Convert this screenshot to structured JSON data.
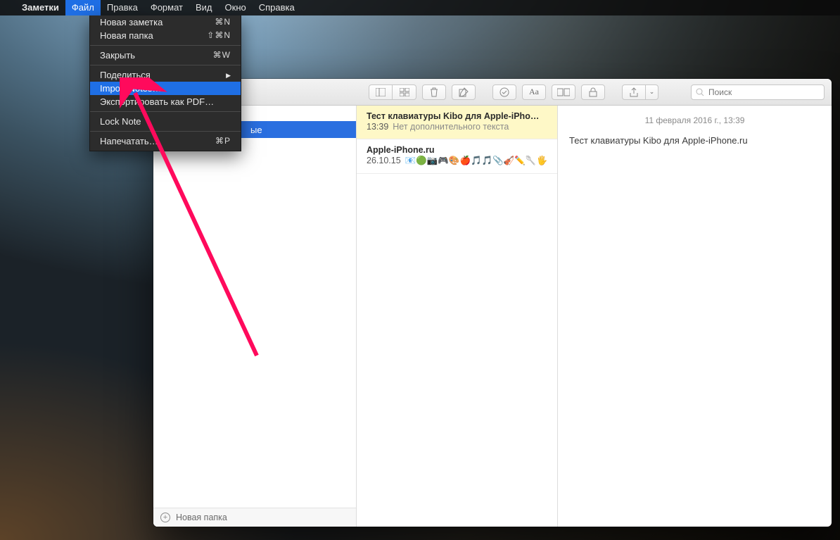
{
  "menu_bar": {
    "app_name": "Заметки",
    "items": [
      "Файл",
      "Правка",
      "Формат",
      "Вид",
      "Окно",
      "Справка"
    ],
    "active_index": 0
  },
  "file_menu": {
    "items": [
      {
        "label": "Новая заметка",
        "shortcut": "⌘N"
      },
      {
        "label": "Новая папка",
        "shortcut": "⇧⌘N"
      },
      {
        "sep": true
      },
      {
        "label": "Закрыть",
        "shortcut": "⌘W"
      },
      {
        "sep": true
      },
      {
        "label": "Поделиться",
        "submenu": true
      },
      {
        "label": "Import Notes…",
        "highlight": true
      },
      {
        "label": "Экспортировать как PDF…"
      },
      {
        "sep": true
      },
      {
        "label": "Lock Note"
      },
      {
        "sep": true
      },
      {
        "label": "Напечатать…",
        "shortcut": "⌘P"
      }
    ]
  },
  "toolbar": {
    "icons": {
      "list_view": "list-view-icon",
      "grid_view": "grid-view-icon",
      "trash": "trash-icon",
      "compose": "compose-icon",
      "checklist": "checklist-icon",
      "font": "font-icon",
      "attachments": "attachments-icon",
      "lock": "lock-icon",
      "share": "share-icon"
    },
    "font_label": "Aa"
  },
  "search": {
    "placeholder": "Поиск"
  },
  "sidebar": {
    "folder_partial_suffix": "ые",
    "new_folder_label": "Новая папка"
  },
  "notes_list": [
    {
      "title": "Тест клавиатуры Kibo для Apple-iPho…",
      "time": "13:39",
      "preview": "Нет дополнительного текста",
      "selected": true
    },
    {
      "title": "Apple-iPhone.ru",
      "time": "26.10.15",
      "preview": "📧🟢📷🎮🎨🍎🎵🎵📎🎻✏️🥄🖐️"
    }
  ],
  "note": {
    "date_header": "11 февраля 2016 г., 13:39",
    "body": "Тест клавиатуры Kibo для Apple-iPhone.ru"
  }
}
